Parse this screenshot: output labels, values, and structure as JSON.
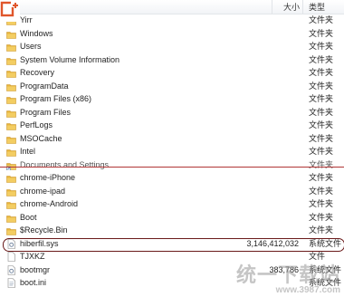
{
  "header": {
    "size_label": "大小",
    "type_label": "类型"
  },
  "rows": [
    {
      "name": "Yirr",
      "size": "",
      "type": "文件夹",
      "icon": "folder-icon"
    },
    {
      "name": "Windows",
      "size": "",
      "type": "文件夹",
      "icon": "folder-icon"
    },
    {
      "name": "Users",
      "size": "",
      "type": "文件夹",
      "icon": "folder-icon"
    },
    {
      "name": "System Volume Information",
      "size": "",
      "type": "文件夹",
      "icon": "folder-icon"
    },
    {
      "name": "Recovery",
      "size": "",
      "type": "文件夹",
      "icon": "folder-icon"
    },
    {
      "name": "ProgramData",
      "size": "",
      "type": "文件夹",
      "icon": "folder-icon"
    },
    {
      "name": "Program Files (x86)",
      "size": "",
      "type": "文件夹",
      "icon": "folder-icon"
    },
    {
      "name": "Program Files",
      "size": "",
      "type": "文件夹",
      "icon": "folder-icon"
    },
    {
      "name": "PerfLogs",
      "size": "",
      "type": "文件夹",
      "icon": "folder-icon"
    },
    {
      "name": "MSOCache",
      "size": "",
      "type": "文件夹",
      "icon": "folder-icon"
    },
    {
      "name": "Intel",
      "size": "",
      "type": "文件夹",
      "icon": "folder-icon"
    },
    {
      "name": "Documents and Settings",
      "size": "",
      "type": "文件夹",
      "icon": "folder-shortcut-icon"
    },
    {
      "name": "chrome-iPhone",
      "size": "",
      "type": "文件夹",
      "icon": "folder-icon"
    },
    {
      "name": "chrome-ipad",
      "size": "",
      "type": "文件夹",
      "icon": "folder-icon"
    },
    {
      "name": "chrome-Android",
      "size": "",
      "type": "文件夹",
      "icon": "folder-icon"
    },
    {
      "name": "Boot",
      "size": "",
      "type": "文件夹",
      "icon": "folder-icon"
    },
    {
      "name": "$Recycle.Bin",
      "size": "",
      "type": "文件夹",
      "icon": "folder-icon"
    },
    {
      "name": "hiberfil.sys",
      "size": "3,146,412,032",
      "type": "系统文件",
      "icon": "system-file-icon"
    },
    {
      "name": "TJXKZ",
      "size": "",
      "type": "文件",
      "icon": "file-icon"
    },
    {
      "name": "bootmgr",
      "size": "383,786",
      "type": "系统文件",
      "icon": "system-file-icon"
    },
    {
      "name": "boot.ini",
      "size": "",
      "type": "系统文件",
      "icon": "text-file-icon"
    }
  ],
  "colors": {
    "folder": "#e8b53a",
    "folder_dark": "#c8922a",
    "strike_line": "#b03535",
    "highlight_oval": "#6a1a1a",
    "logo": "#e0562b"
  },
  "watermark": {
    "title": "统一下载站",
    "url": "www.3987.com"
  }
}
